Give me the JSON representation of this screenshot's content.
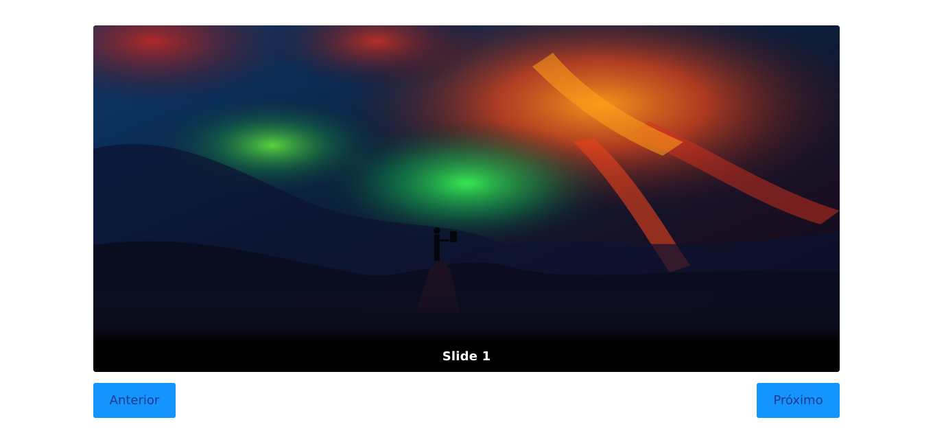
{
  "carousel": {
    "caption": "Slide 1",
    "image_description_icon": "volcano-painting-image"
  },
  "controls": {
    "prev_label": "Anterior",
    "next_label": "Próximo"
  },
  "colors": {
    "button_bg": "#1494fd",
    "button_text": "#1f3a8a",
    "caption_bg": "#000000",
    "caption_text": "#ffffff"
  }
}
